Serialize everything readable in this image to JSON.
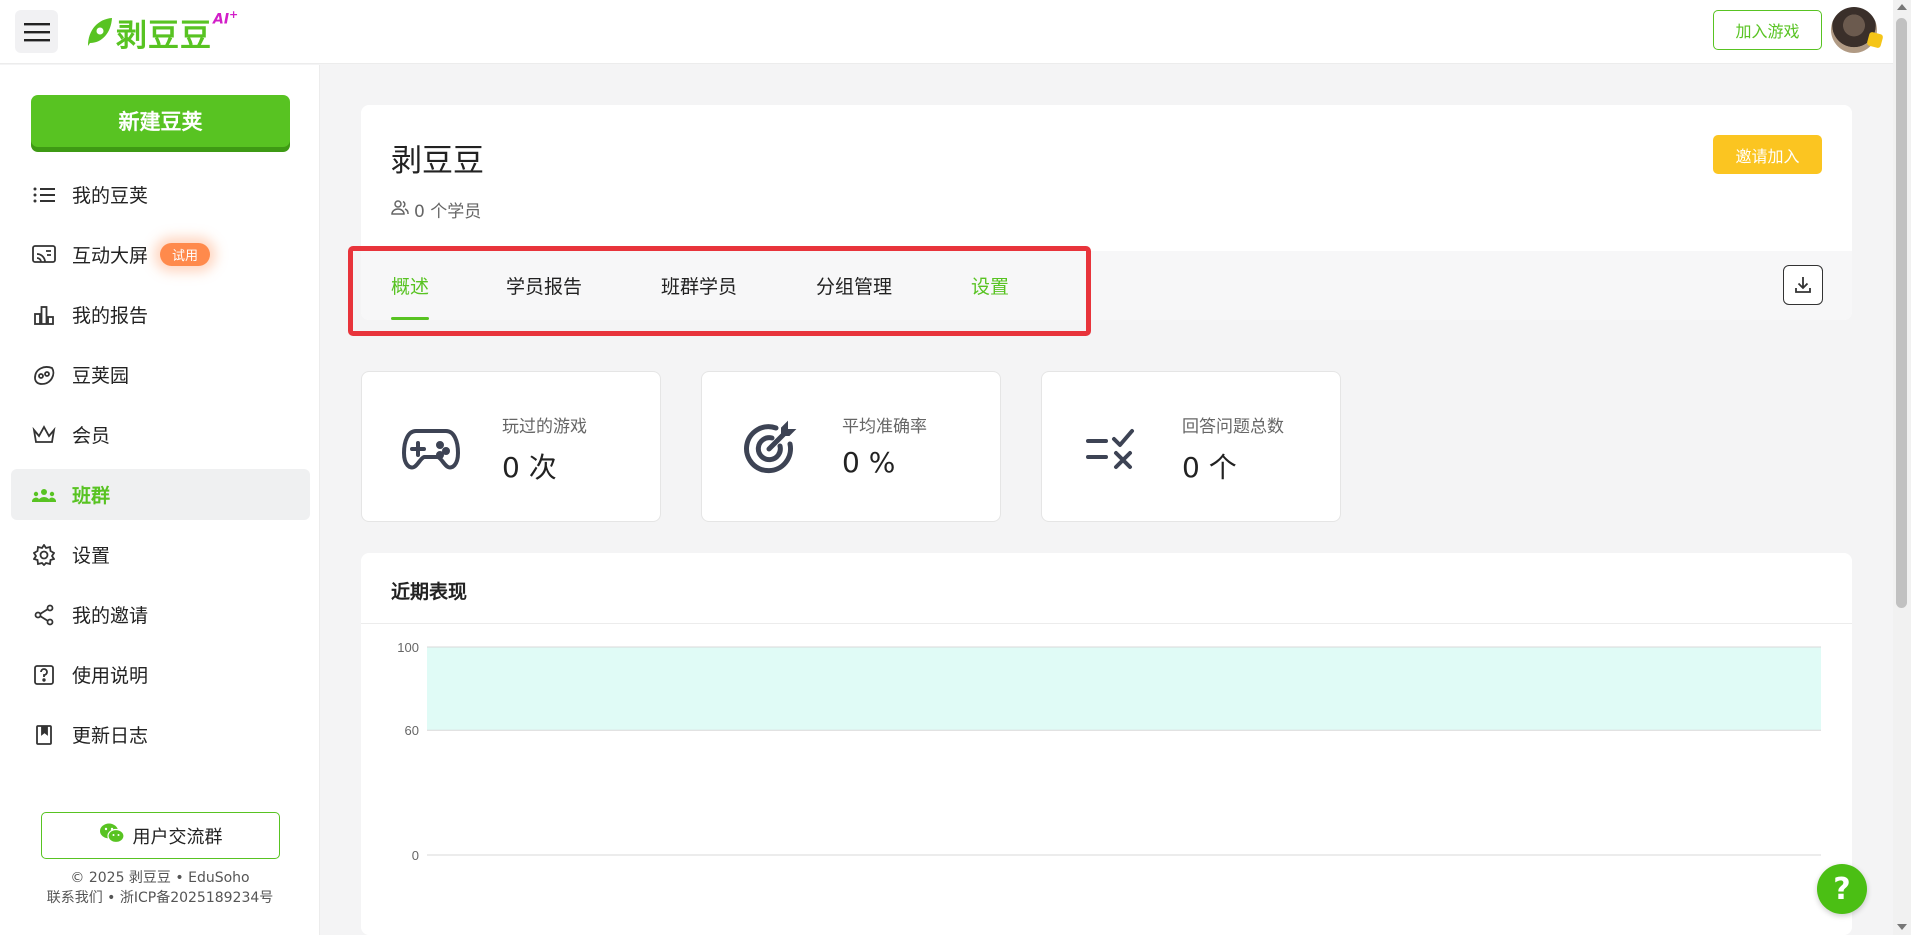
{
  "app": {
    "logo_text": "剥豆豆",
    "logo_badge": "AI",
    "logo_badge_plus": "+"
  },
  "topbar": {
    "join_label": "加入游戏"
  },
  "sidebar": {
    "new_label": "新建豆荚",
    "items": [
      {
        "label": "我的豆荚",
        "icon": "list-icon"
      },
      {
        "label": "互动大屏",
        "icon": "cast-screen-icon",
        "badge": "试用"
      },
      {
        "label": "我的报告",
        "icon": "bar-chart-icon"
      },
      {
        "label": "豆荚园",
        "icon": "pea-icon"
      },
      {
        "label": "会员",
        "icon": "crown-icon"
      },
      {
        "label": "班群",
        "icon": "group-icon",
        "active": true
      },
      {
        "label": "设置",
        "icon": "gear-icon"
      },
      {
        "label": "我的邀请",
        "icon": "share-icon"
      },
      {
        "label": "使用说明",
        "icon": "help-box-icon"
      },
      {
        "label": "更新日志",
        "icon": "book-icon"
      }
    ],
    "group_btn_label": "用户交流群",
    "copyright_line1": "© 2025 剥豆豆 • EduSoho",
    "copyright_line2": "联系我们 • 浙ICP备2025189234号"
  },
  "header": {
    "title": "剥豆豆",
    "student_count": "0 个学员",
    "invite_label": "邀请加入",
    "tabs": [
      "概述",
      "学员报告",
      "班群学员",
      "分组管理",
      "设置"
    ],
    "active_tab": "概述"
  },
  "stats": [
    {
      "label": "玩过的游戏",
      "value": "0 次",
      "icon": "gamepad-icon"
    },
    {
      "label": "平均准确率",
      "value": "0 %",
      "icon": "target-icon"
    },
    {
      "label": "回答问题总数",
      "value": "0 个",
      "icon": "checklist-icon"
    }
  ],
  "chart": {
    "title": "近期表现"
  },
  "chart_data": {
    "type": "line",
    "title": "近期表现",
    "y_ticks": [
      "100",
      "60",
      "0"
    ],
    "ylim": [
      0,
      100
    ],
    "band": {
      "from": 60,
      "to": 100,
      "color": "#e0fbf6"
    },
    "series": [],
    "grid": true
  },
  "colors": {
    "brand_green": "#58c322",
    "invite_yellow": "#fbc521",
    "highlight_red": "#e8343b",
    "trial_orange": "#ff8a4c"
  },
  "help_label": "?"
}
